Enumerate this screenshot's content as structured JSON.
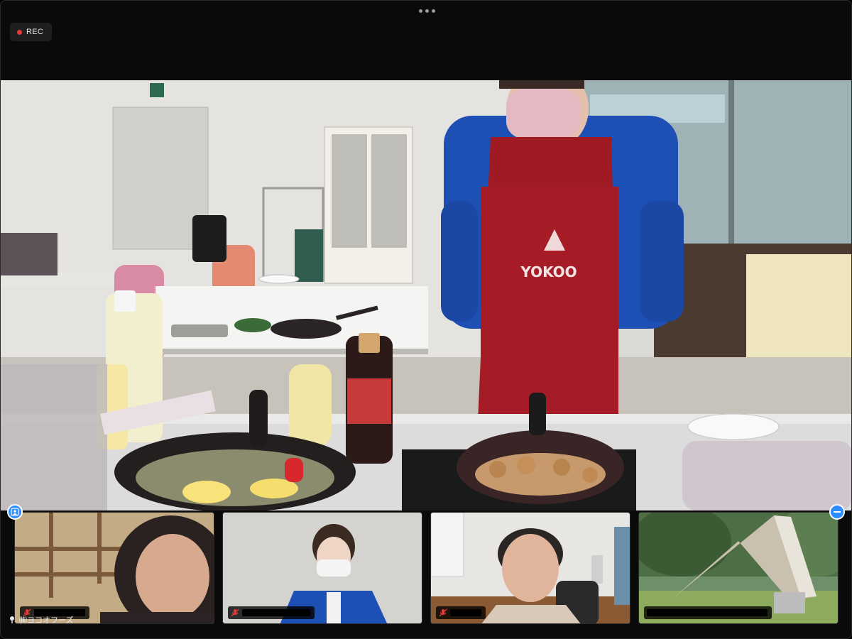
{
  "recording": {
    "label": "REC",
    "dot_color": "#e23b3b"
  },
  "toolbar": {
    "more_icon": "more-dots-icon"
  },
  "main_video": {
    "apron_text": "YOKOO",
    "apron_color": "#a01a24",
    "jacket_color": "#1d4fb5"
  },
  "gallery": {
    "tiles": [
      {
        "mic_icon": "mic-muted-icon"
      },
      {
        "mic_icon": "mic-muted-icon"
      },
      {
        "mic_icon": "mic-muted-icon"
      },
      {
        "mic_icon": "none"
      }
    ]
  },
  "controls": {
    "left_icon": "self-view-icon",
    "right_icon": "minimize-icon",
    "accent": "#2d8cff"
  },
  "active_speaker": {
    "name": "㈱ヨコオフーズ",
    "icon": "pin-icon"
  }
}
